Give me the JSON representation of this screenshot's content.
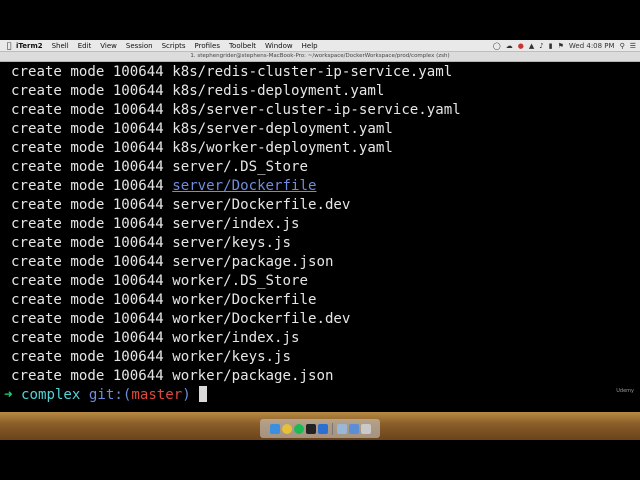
{
  "menubar": {
    "app": "iTerm2",
    "items": [
      "Shell",
      "Edit",
      "View",
      "Session",
      "Scripts",
      "Profiles",
      "Toolbelt",
      "Window",
      "Help"
    ],
    "clock": "Wed 4:08 PM"
  },
  "window": {
    "title": "1. stephengrider@stephens-MacBook-Pro: ~/workspace/DockerWorkspace/prod/complex (zsh)"
  },
  "terminal": {
    "prefix": "create mode 100644 ",
    "lines": [
      "k8s/redis-cluster-ip-service.yaml",
      "k8s/redis-deployment.yaml",
      "k8s/server-cluster-ip-service.yaml",
      "k8s/server-deployment.yaml",
      "k8s/worker-deployment.yaml",
      "server/.DS_Store",
      "server/Dockerfile",
      "server/Dockerfile.dev",
      "server/index.js",
      "server/keys.js",
      "server/package.json",
      "worker/.DS_Store",
      "worker/Dockerfile",
      "worker/Dockerfile.dev",
      "worker/index.js",
      "worker/keys.js",
      "worker/package.json"
    ],
    "prompt": {
      "arrow": "➜",
      "dir": "complex",
      "git": "git:(",
      "branch": "master",
      "close": ")"
    }
  },
  "watermark": "Udemy",
  "dock": {
    "icons": [
      "finder-icon",
      "chrome-icon",
      "spotify-icon",
      "terminal-icon",
      "xcode-icon",
      "preview-icon",
      "downloads-icon",
      "trash-icon"
    ],
    "colors": [
      "#3a8fe0",
      "#e8c038",
      "#1db954",
      "#222222",
      "#2a6fd1",
      "#9bb7d8",
      "#5a8fd8",
      "#c9c9c9"
    ]
  }
}
